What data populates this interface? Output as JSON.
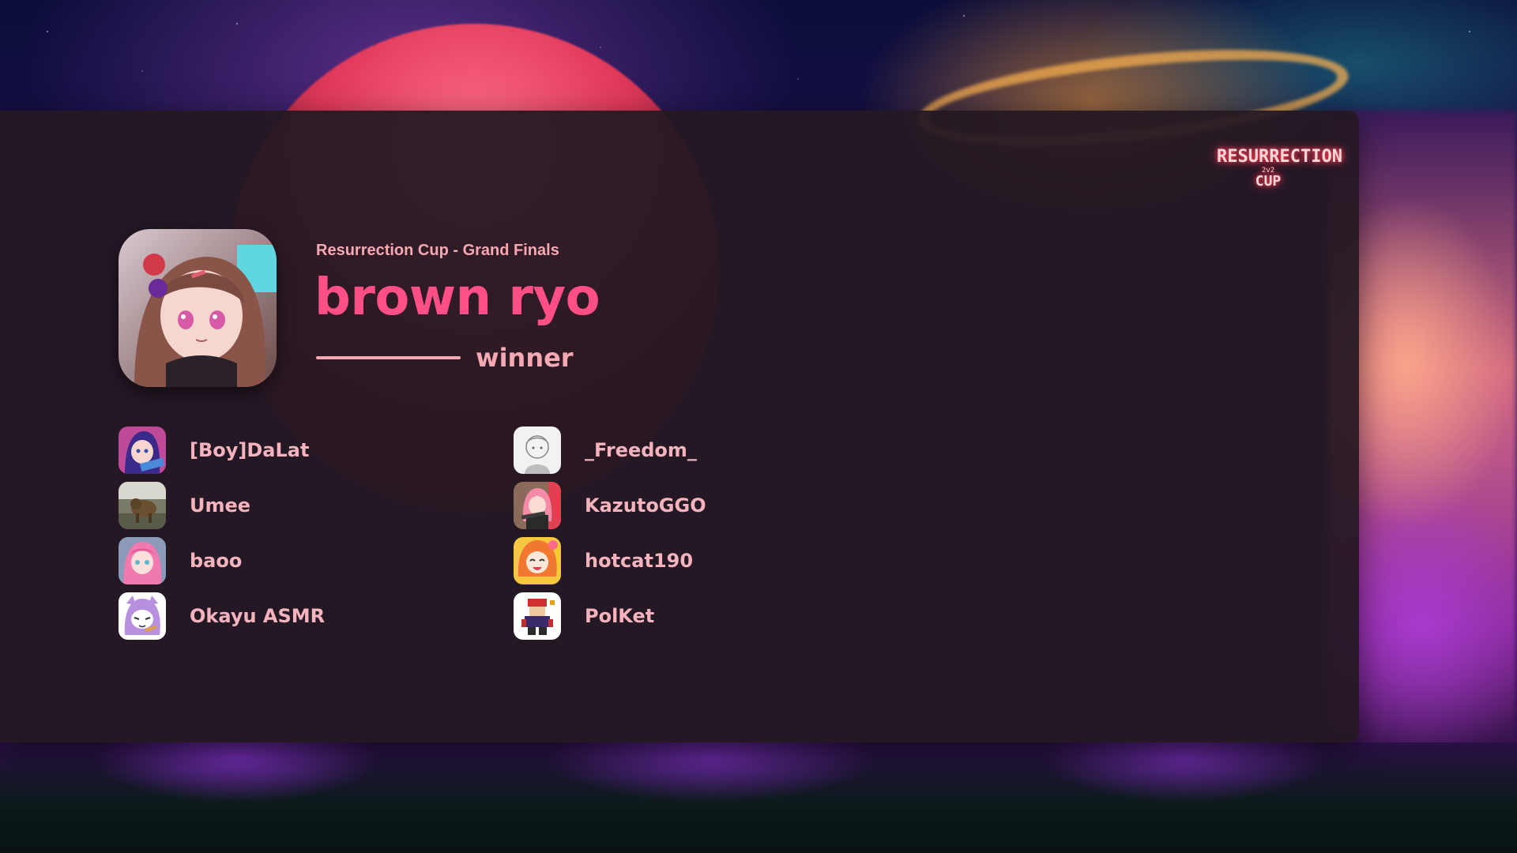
{
  "event": {
    "subtitle": "Resurrection Cup - Grand Finals",
    "logo_line1": "RESURRECTION",
    "logo_line2": "2v2",
    "logo_line3": "CUP"
  },
  "winner": {
    "name": "brown ryo",
    "label": "winner",
    "avatar_icon": "anime-girl-avatar"
  },
  "players": [
    {
      "name": "[Boy]DaLat",
      "avatar_icon": "anime-avatar"
    },
    {
      "name": "_Freedom_",
      "avatar_icon": "sketch-avatar"
    },
    {
      "name": "Umee",
      "avatar_icon": "animal-photo-avatar"
    },
    {
      "name": "KazutoGGO",
      "avatar_icon": "anime-avatar"
    },
    {
      "name": "baoo",
      "avatar_icon": "anime-avatar"
    },
    {
      "name": "hotcat190",
      "avatar_icon": "anime-avatar"
    },
    {
      "name": "Okayu ASMR",
      "avatar_icon": "anime-avatar"
    },
    {
      "name": "PolKet",
      "avatar_icon": "pixel-art-avatar"
    }
  ],
  "colors": {
    "accent": "#ff4f86",
    "text_pink": "#f4a9b3",
    "panel": "#241822"
  }
}
